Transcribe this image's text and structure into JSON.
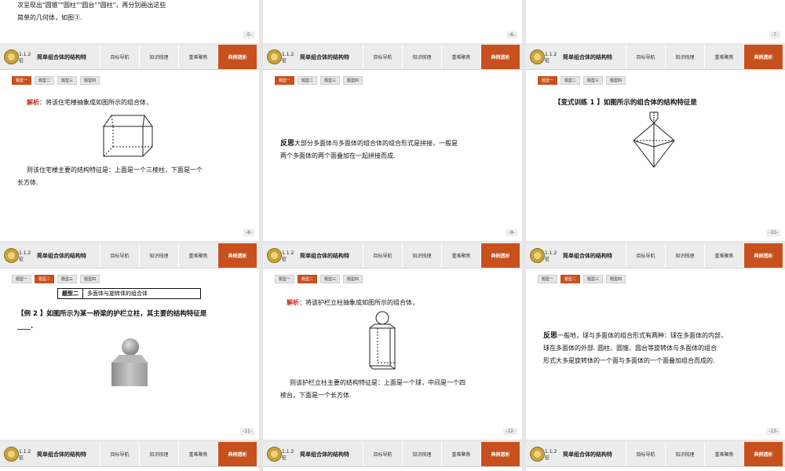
{
  "header": {
    "section": "1.1.2",
    "section_tail": "征",
    "title": "简单组合体的结构特",
    "tabs": [
      "目标导航",
      "知识梳理",
      "重难聚焦",
      "典例透析"
    ],
    "active_tab": 3
  },
  "subtabs": [
    "题型一",
    "题型二",
    "题型三",
    "题型四"
  ],
  "top_row": {
    "text_line1": "次呈现出\"圆锥\"\"圆柱\"\"圆台\"\"圆柱\"，再分别画出这些",
    "text_line2": "简单的几何体，如图③.",
    "pages": [
      "-5-",
      "-6-",
      "-7-"
    ]
  },
  "slide8": {
    "page": "-8-",
    "active_subtab": 0,
    "label": "解析",
    "line1": "：将该住宅楼抽象成如图所示的组合体，",
    "line2": "则该住宅楼主要的结构特征是：上面是一个三棱柱，下面是一个",
    "line3": "长方体."
  },
  "slide9": {
    "page": "-9-",
    "active_subtab": 0,
    "label": "反思",
    "line1": "大部分多面体与多面体的组合体的组合形式是拼接，一般是",
    "line2": "两个多面体的两个面叠加在一起拼接而成."
  },
  "slide10": {
    "page": "-10-",
    "active_subtab": 0,
    "heading": "【变式训练 1 】如图所示的组合体的结构特征是"
  },
  "slide11": {
    "page": "-11-",
    "active_subtab": 1,
    "box_left": "题型二",
    "box_right": "多面体与旋转体的组合体",
    "line1": "【例 2 】如图所示为某一桥梁的护栏立柱，其主要的结构特征是",
    "line2": "____."
  },
  "slide12": {
    "page": "-12-",
    "active_subtab": 1,
    "label": "解析",
    "line1": "：将该护栏立柱抽象成如图所示的组合体，",
    "line2": "则该护栏立柱主要的结构特征是：上面是一个球，中间是一个四",
    "line3": "棱台，下面是一个长方体."
  },
  "slide13": {
    "page": "-13-",
    "active_subtab": 1,
    "label": "反思",
    "line1": "一般地，球与多面体的组合形式有两种：球在多面体的内部，",
    "line2": "球在多面体的外部. 圆柱、圆锥、圆台等旋转体与多面体的组合",
    "line3": "形式大多是旋转体的一个面与多面体的一个面叠加组合而成的."
  },
  "colors": {
    "accent": "#c8501d",
    "red_label": "#d4281c"
  }
}
